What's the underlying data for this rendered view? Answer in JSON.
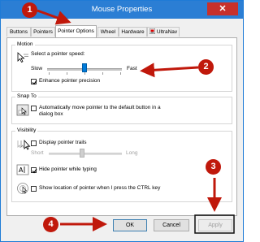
{
  "window": {
    "title": "Mouse Properties",
    "close_glyph": "✕"
  },
  "tabs": [
    {
      "label": "Buttons"
    },
    {
      "label": "Pointers"
    },
    {
      "label": "Pointer Options"
    },
    {
      "label": "Wheel"
    },
    {
      "label": "Hardware"
    },
    {
      "label": "UltraNav"
    }
  ],
  "motion": {
    "title": "Motion",
    "speed_label": "Select a pointer speed:",
    "slow_label": "Slow",
    "fast_label": "Fast",
    "speed_level": 0.5,
    "precision_label": "Enhance pointer precision",
    "precision_checked": true
  },
  "snap_to": {
    "title": "Snap To",
    "line1": "Automatically move pointer to the default button in a",
    "line2": "dialog box",
    "checked": false
  },
  "visibility": {
    "title": "Visibility",
    "trails_label": "Display pointer trails",
    "trails_checked": false,
    "short_label": "Short",
    "long_label": "Long",
    "hide_label": "Hide pointer while typing",
    "hide_checked": true,
    "ctrl_label": "Show location of pointer when I press the CTRL key",
    "ctrl_checked": false
  },
  "buttons": {
    "ok": "OK",
    "cancel": "Cancel",
    "apply": "Apply"
  },
  "annotations": [
    "1",
    "2",
    "3",
    "4"
  ],
  "colors": {
    "annotation": "#c0180b",
    "accent": "#2b7ed4",
    "close": "#c7302b"
  }
}
